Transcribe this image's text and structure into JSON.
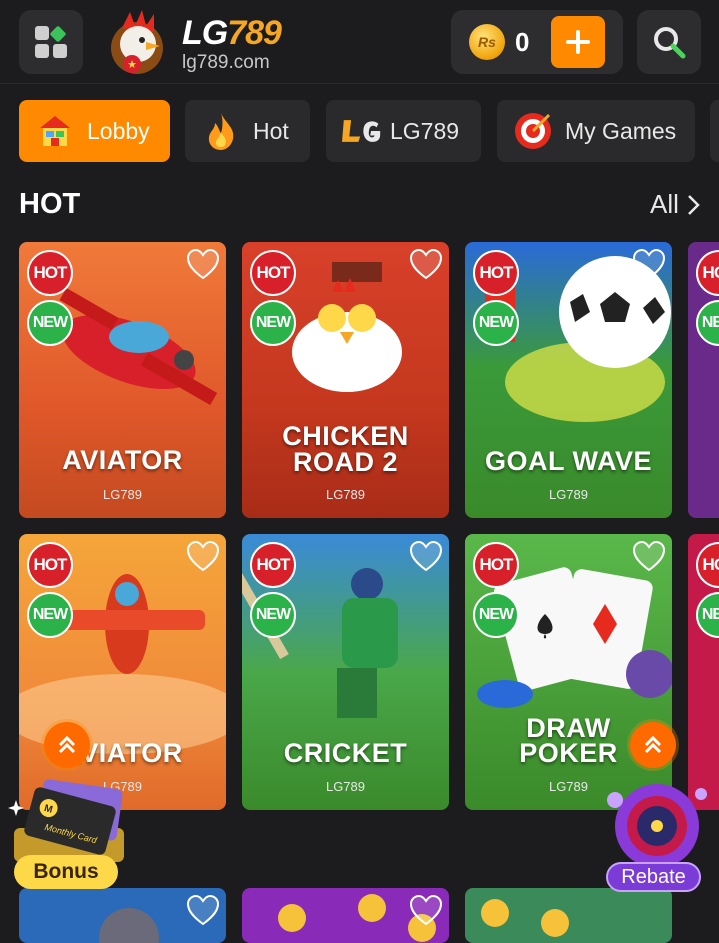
{
  "header": {
    "logo_lg": "LG",
    "logo_num": "789",
    "logo_url": "lg789.com",
    "coin_symbol": "Rs",
    "balance": "0"
  },
  "tabs": [
    {
      "label": "Lobby",
      "icon": "lobby-icon",
      "active": true
    },
    {
      "label": "Hot",
      "icon": "fire-icon",
      "active": false
    },
    {
      "label": "LG789",
      "icon": "lg-logo-icon",
      "active": false
    },
    {
      "label": "My Games",
      "icon": "target-icon",
      "active": false
    }
  ],
  "section": {
    "title": "HOT",
    "all_label": "All"
  },
  "badges": {
    "hot": "HOT",
    "new": "NEW"
  },
  "games": [
    {
      "name_line1": "AVIATOR",
      "name_line2": "",
      "provider": "LG789",
      "theme": "orange-plane"
    },
    {
      "name_line1": "CHICKEN",
      "name_line2": "ROAD 2",
      "provider": "LG789",
      "theme": "red-chicken"
    },
    {
      "name_line1": "GOAL WAVE",
      "name_line2": "",
      "provider": "LG789",
      "theme": "green-soccer"
    },
    {
      "name_line1": "AVIATOR",
      "name_line2": "",
      "provider": "LG789",
      "theme": "orange-plane-2"
    },
    {
      "name_line1": "CRICKET",
      "name_line2": "",
      "provider": "LG789",
      "theme": "green-cricket"
    },
    {
      "name_line1": "DRAW",
      "name_line2": "POKER",
      "provider": "LG789",
      "theme": "green-poker"
    }
  ],
  "widgets": {
    "bonus_label": "Bonus",
    "bonus_card_text": "Monthly Card",
    "rebate_label": "Rebate"
  },
  "colors": {
    "accent": "#ff8a00",
    "background": "#1c1c1e",
    "hot_badge": "#d8202a",
    "new_badge": "#2bb34a"
  }
}
